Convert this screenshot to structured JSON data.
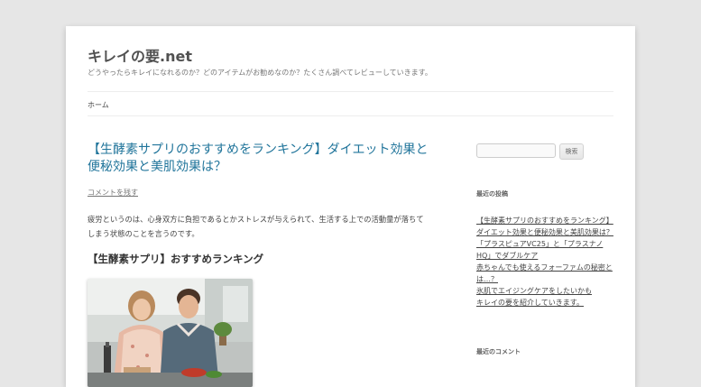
{
  "site": {
    "title": "キレイの要.net",
    "description": "どうやったらキレイになれるのか？どのアイテムがお勧めなのか？たくさん調べてレビューしていきます。"
  },
  "nav": {
    "home": "ホーム"
  },
  "post": {
    "title": "【生酵素サプリのおすすめをランキング】ダイエット効果と便秘効果と美肌効果は？",
    "comment_link": "コメントを残す",
    "intro": "疲労というのは、心身双方に負担であるとかストレスが与えられて、生活する上での活動量が落ちてしまう状態のことを言うのです。",
    "heading": "【生酵素サプリ】おすすめランキング"
  },
  "sidebar": {
    "search": {
      "placeholder": "",
      "button_label": "検索"
    },
    "recent_posts": {
      "title": "最近の投稿",
      "items": [
        "【生酵素サプリのおすすめをランキング】",
        "ダイエット効果と便秘効果と美肌効果は？",
        "「プラスピュアVC25」と「プラスナノ",
        "HQ」でダブルケア",
        "赤ちゃんでも使えるフォーファムの秘密と",
        "は…？",
        "氷肌でエイジングケアをしたいかも",
        "キレイの要を紹介していきます。"
      ]
    },
    "recent_comments": {
      "title": "最近のコメント"
    }
  },
  "colors": {
    "background": "#e6e6e6",
    "link": "#21759b",
    "text": "#444444"
  }
}
